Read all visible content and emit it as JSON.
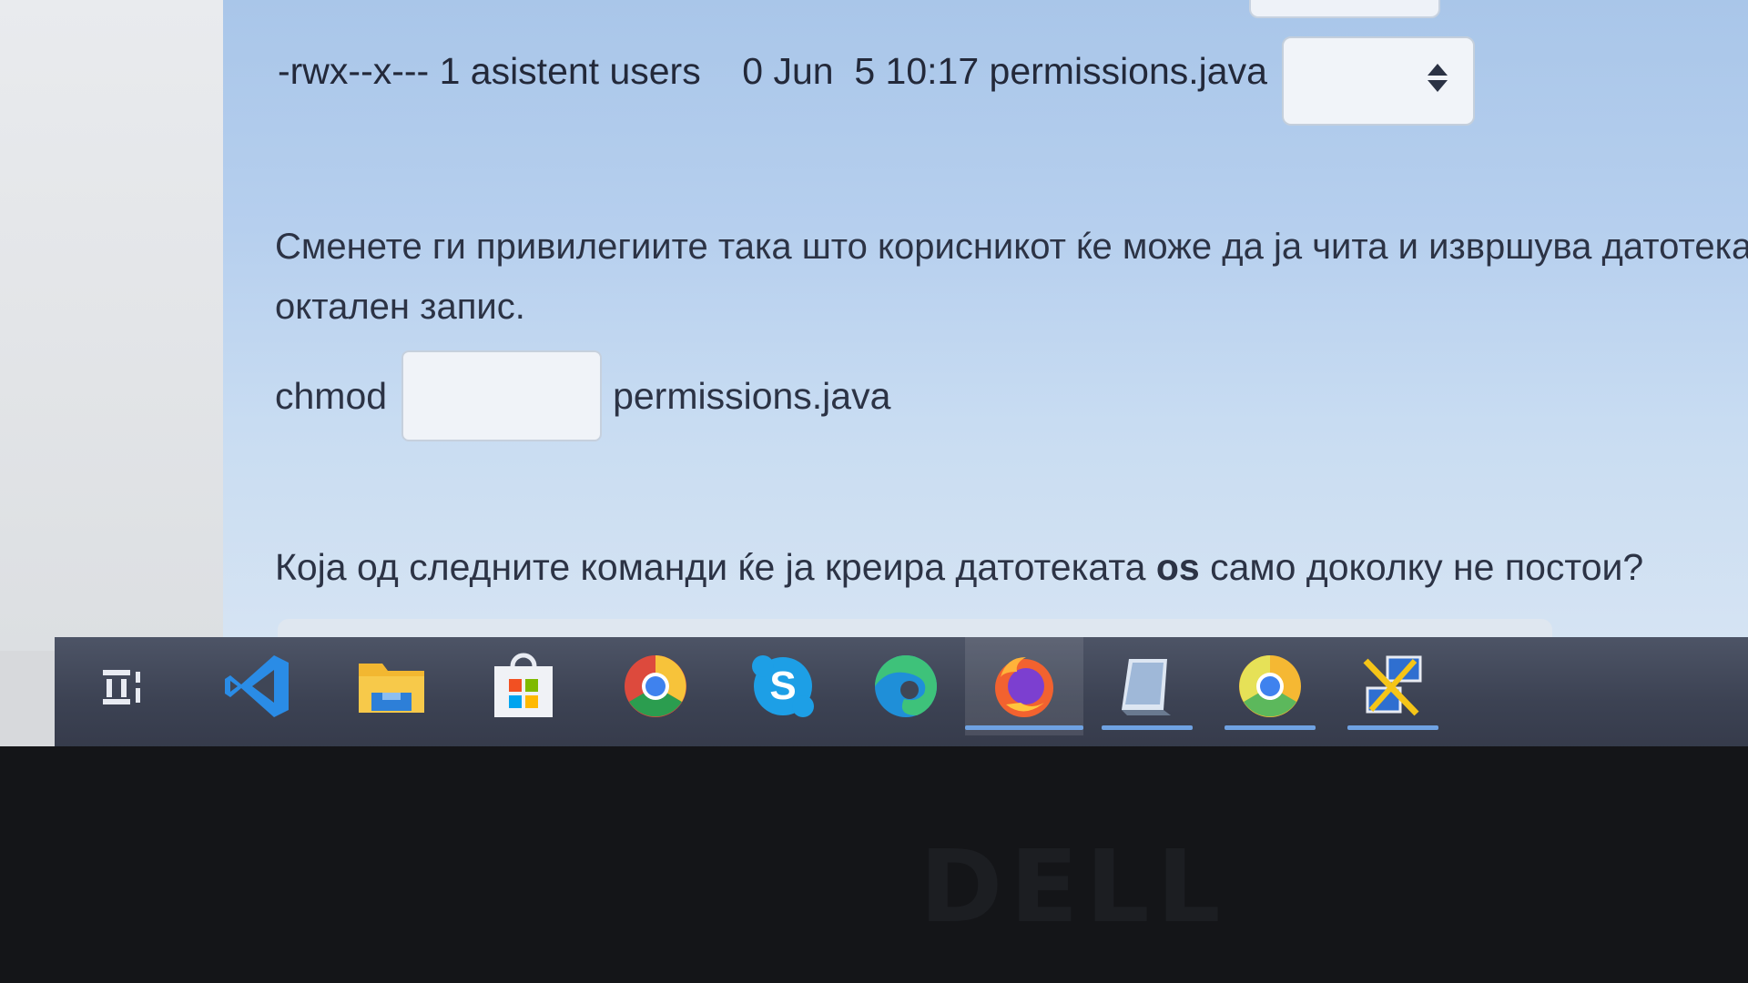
{
  "exam": {
    "permission_line": "-rwx--x--- 1 asistent users    0 Jun  5 10:17 permissions.java",
    "question_line1": "Сменете ги привилегиите така што корисникот ќе може да ја чита и извршува датотеката",
    "question_line2": "октален запис.",
    "chmod_prefix": "chmod",
    "chmod_input_value": "",
    "chmod_suffix": "permissions.java",
    "question2_part1": "Која од следните команди ќе ја креира датотеката ",
    "question2_bold": "os",
    "question2_part2": " само доколку не постои?"
  },
  "taskbar": {
    "items": [
      {
        "icon": "task-view-icon",
        "active": false,
        "open": false
      },
      {
        "icon": "vscode-icon",
        "active": false,
        "open": false
      },
      {
        "icon": "file-explorer-icon",
        "active": false,
        "open": false
      },
      {
        "icon": "microsoft-store-icon",
        "active": false,
        "open": false
      },
      {
        "icon": "chrome-icon",
        "active": false,
        "open": false
      },
      {
        "icon": "skype-icon",
        "active": false,
        "open": false
      },
      {
        "icon": "edge-icon",
        "active": false,
        "open": false
      },
      {
        "icon": "firefox-icon",
        "active": true,
        "open": true
      },
      {
        "icon": "virtualbox-icon",
        "active": false,
        "open": true
      },
      {
        "icon": "chrome-canary-icon",
        "active": false,
        "open": true
      },
      {
        "icon": "remote-tools-icon",
        "active": false,
        "open": true
      }
    ]
  },
  "bezel": {
    "brand": "DELL"
  }
}
